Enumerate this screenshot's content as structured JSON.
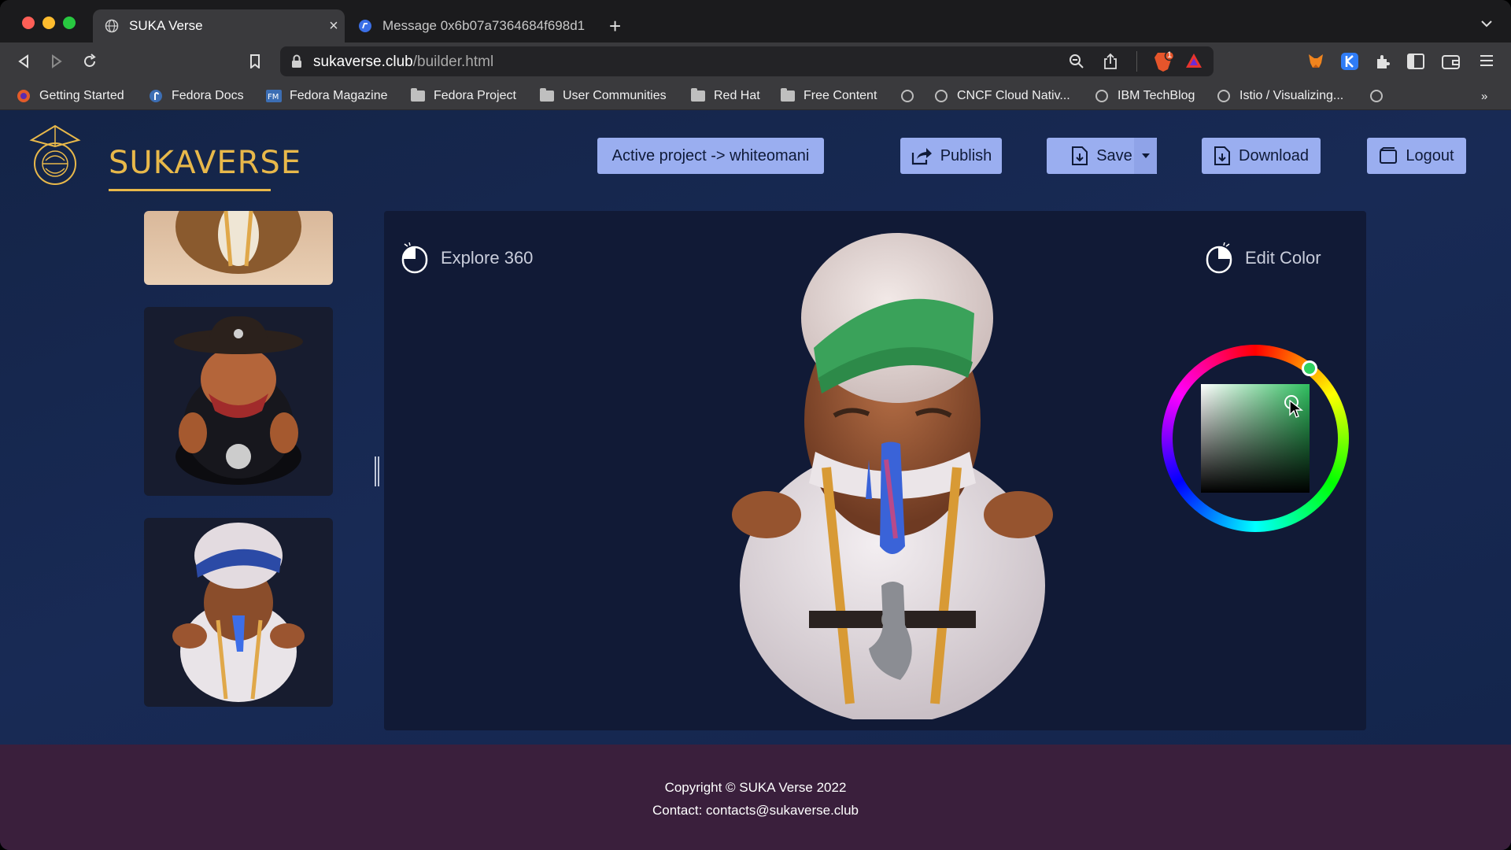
{
  "browser": {
    "tabs": [
      {
        "title": "SUKA Verse",
        "active": true
      },
      {
        "title": "Message 0x6b07a7364684f698d1",
        "active": false
      }
    ],
    "url_domain": "sukaverse.club",
    "url_path": "/builder.html",
    "bookmarks": [
      "Getting Started",
      "Fedora Docs",
      "Fedora Magazine",
      "Fedora Project",
      "User Communities",
      "Red Hat",
      "Free Content",
      "CNCF Cloud Nativ...",
      "IBM TechBlog",
      "Istio / Visualizing..."
    ],
    "brave_badge": "1"
  },
  "header": {
    "logo_text": "SUKAVERSE",
    "active_project": "Active project -> whiteomani",
    "publish_label": "Publish",
    "save_label": "Save",
    "download_label": "Download",
    "logout_label": "Logout"
  },
  "viewer": {
    "explore_label": "Explore 360",
    "edit_color_label": "Edit Color",
    "selected_hue": "#2fbf5f"
  },
  "footer": {
    "copyright": "Copyright © SUKA Verse 2022",
    "contact": "Contact: contacts@sukaverse.club"
  }
}
